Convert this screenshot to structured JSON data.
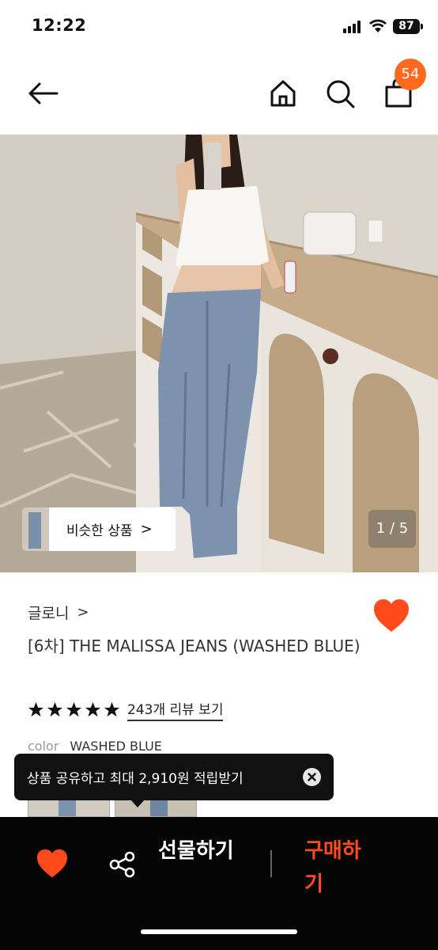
{
  "status": {
    "time": "12:22",
    "battery": "87"
  },
  "nav": {
    "cart_count": "54"
  },
  "hero": {
    "similar_label": "비슷한 상품",
    "similar_chevron": ">",
    "pager": "1 / 5"
  },
  "product": {
    "brand": "글로니",
    "brand_chevron": ">",
    "title": "[6차] THE MALISSA JEANS (WASHED BLUE)",
    "rating_stars": 5,
    "review_link": "243개 리뷰 보기",
    "color_label": "color",
    "color_value": "WASHED BLUE"
  },
  "toast": {
    "text": "상품 공유하고 최대 2,910원 적립받기"
  },
  "bottom": {
    "gift_label": "선물하기",
    "buy_label": "구매하기"
  },
  "colors": {
    "accent": "#ff6a1f",
    "like": "#ff4a1c",
    "buy": "#ff4a1c",
    "bottom_bg": "#050505"
  }
}
